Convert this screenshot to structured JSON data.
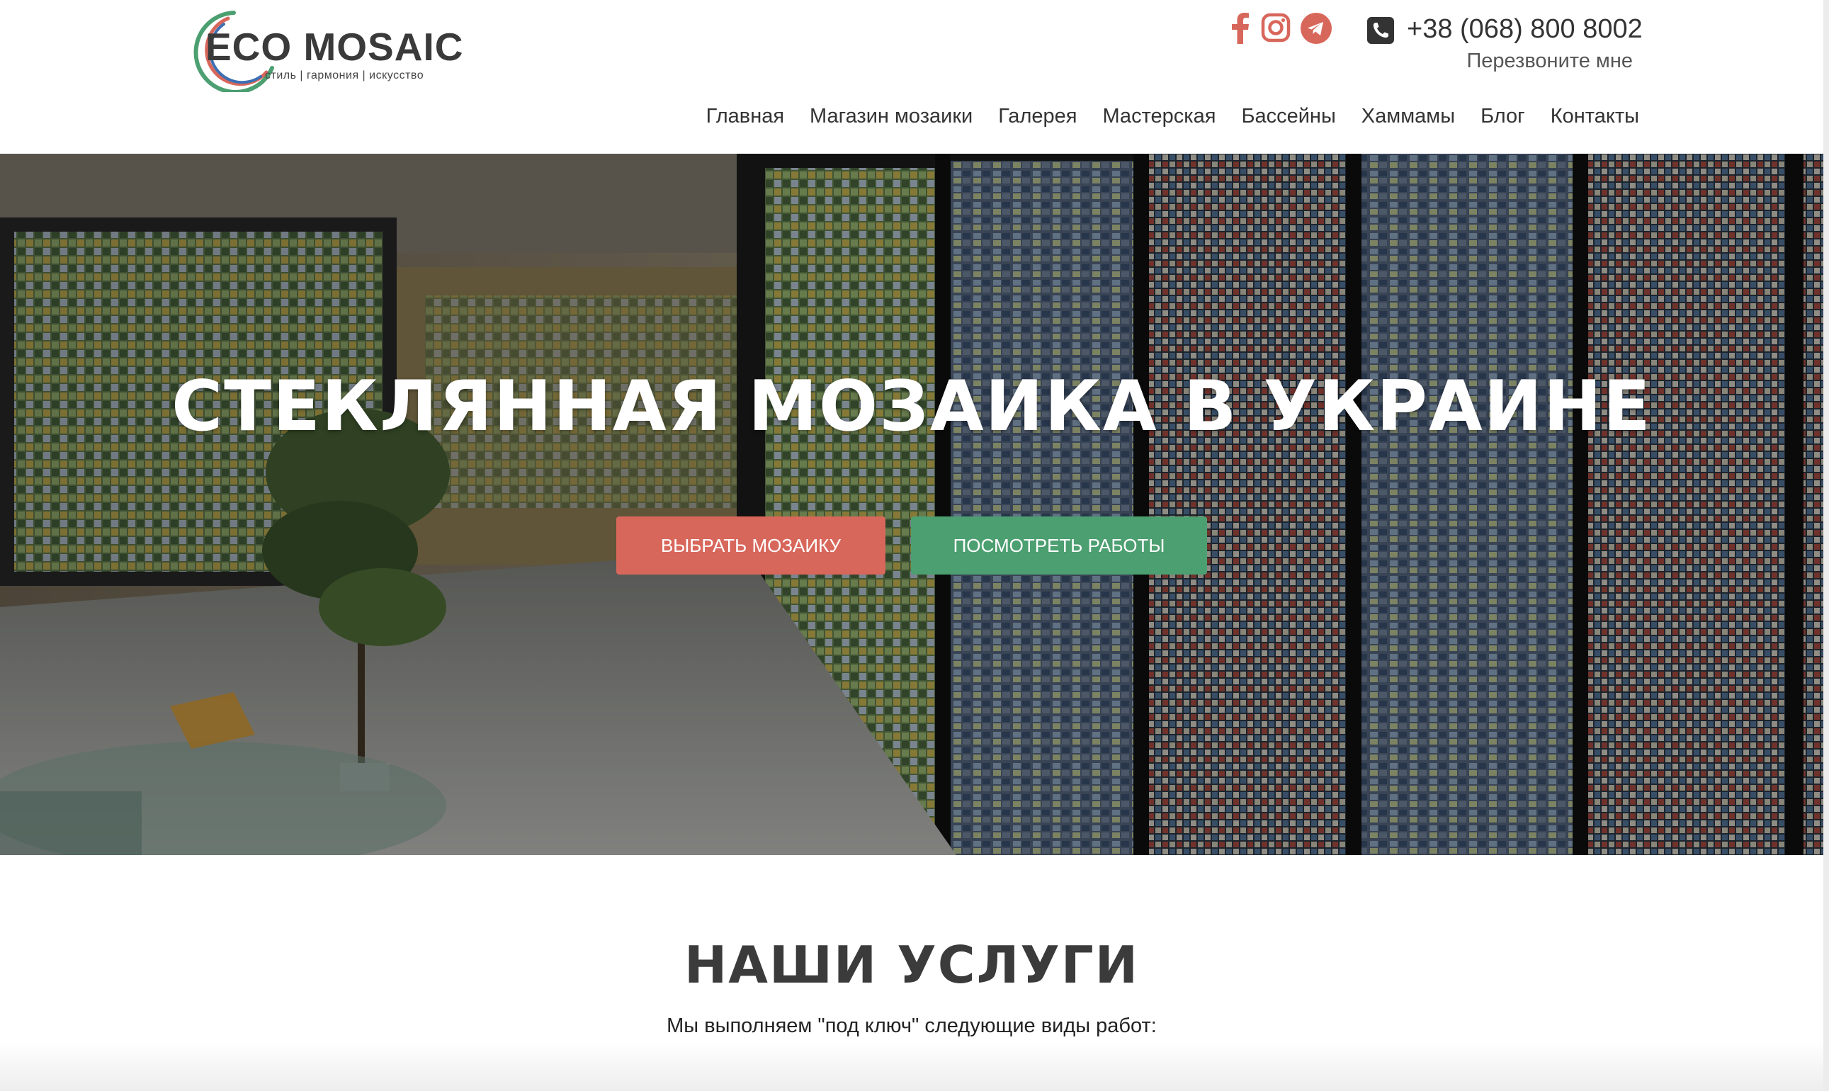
{
  "brand": {
    "name": "ECO MOSAIC",
    "tagline": "стиль | гармония | искусство",
    "colors": {
      "arc_green": "#4c9f70",
      "arc_red": "#d8675b",
      "arc_blue": "#3b6fb3"
    }
  },
  "header": {
    "social": [
      {
        "icon": "facebook-icon",
        "color": "#d8675b"
      },
      {
        "icon": "instagram-icon",
        "color": "#d8675b"
      },
      {
        "icon": "telegram-icon",
        "color": "#d8675b"
      }
    ],
    "phone_icon": "phone-icon",
    "phone": "+38 (068) 800 8002",
    "callback": "Перезвоните мне"
  },
  "nav": {
    "items": [
      {
        "label": "Главная"
      },
      {
        "label": "Магазин мозаики"
      },
      {
        "label": "Галерея"
      },
      {
        "label": "Мастерская"
      },
      {
        "label": "Бассейны"
      },
      {
        "label": "Хаммамы"
      },
      {
        "label": "Блог"
      },
      {
        "label": "Контакты"
      }
    ]
  },
  "hero": {
    "title": "СТЕКЛЯННАЯ МОЗАИКА В УКРАИНЕ",
    "buttons": [
      {
        "label": "ВЫБРАТЬ МОЗАИКУ",
        "color": "#d8675b"
      },
      {
        "label": "ПОСМОТРЕТЬ РАБОТЫ",
        "color": "#4c9f70"
      }
    ]
  },
  "services": {
    "title": "НАШИ УСЛУГИ",
    "subtitle": "Мы выполняем \"под ключ\" следующие виды работ:"
  }
}
